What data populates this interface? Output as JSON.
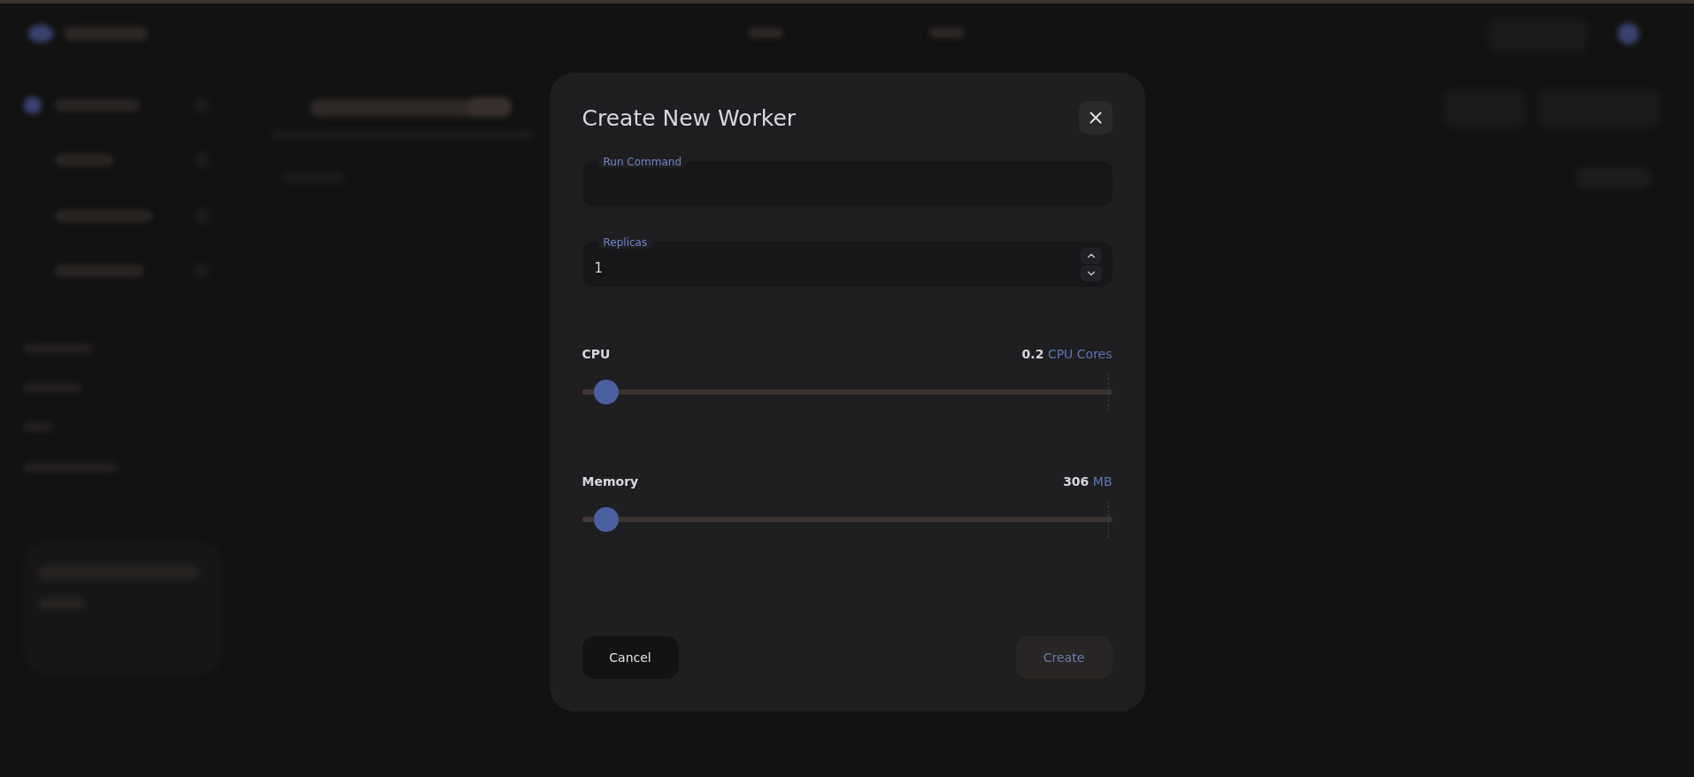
{
  "dialog": {
    "title": "Create New Worker",
    "fields": [
      {
        "label": "Run Command",
        "kind": "text"
      },
      {
        "label": "Replicas",
        "value": "1",
        "kind": "number"
      }
    ],
    "sliders": [
      {
        "label": "CPU",
        "amount": "0.2",
        "unit": "CPU Cores",
        "level": 0.02
      },
      {
        "label": "Memory",
        "amount": "306",
        "unit": "MB",
        "level": 0.02
      }
    ],
    "buttons": [
      {
        "label": "Cancel",
        "kind": "secondary",
        "disabled": false
      },
      {
        "label": "Create",
        "kind": "primary",
        "disabled": true
      }
    ]
  }
}
